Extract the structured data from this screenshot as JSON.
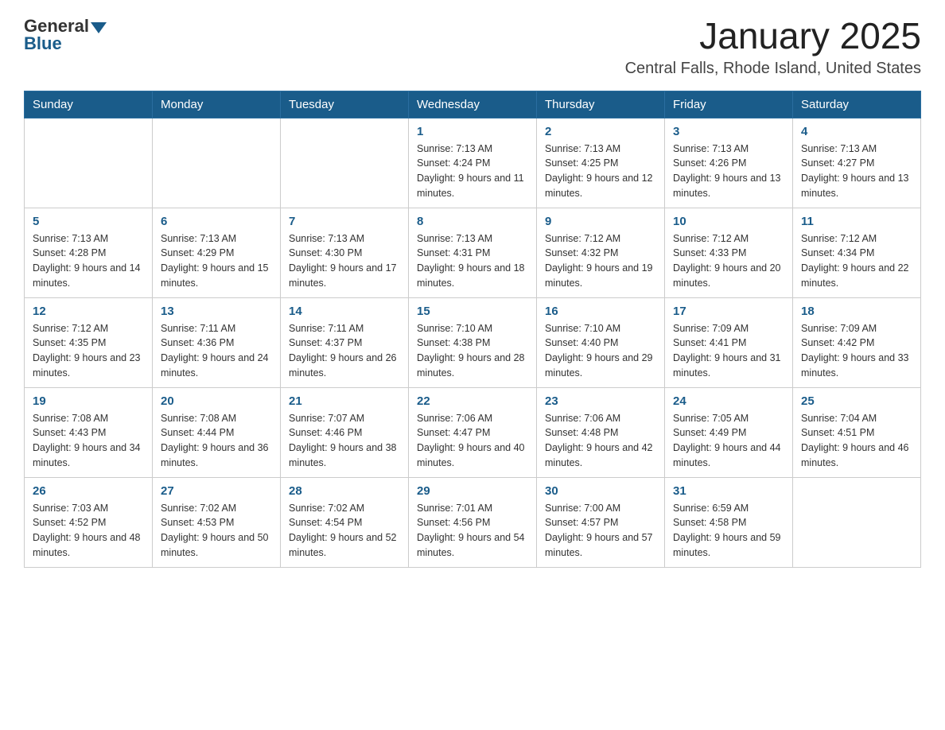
{
  "logo": {
    "general": "General",
    "blue": "Blue"
  },
  "title": {
    "month_year": "January 2025",
    "location": "Central Falls, Rhode Island, United States"
  },
  "days_of_week": [
    "Sunday",
    "Monday",
    "Tuesday",
    "Wednesday",
    "Thursday",
    "Friday",
    "Saturday"
  ],
  "weeks": [
    [
      {
        "day": "",
        "info": ""
      },
      {
        "day": "",
        "info": ""
      },
      {
        "day": "",
        "info": ""
      },
      {
        "day": "1",
        "info": "Sunrise: 7:13 AM\nSunset: 4:24 PM\nDaylight: 9 hours and 11 minutes."
      },
      {
        "day": "2",
        "info": "Sunrise: 7:13 AM\nSunset: 4:25 PM\nDaylight: 9 hours and 12 minutes."
      },
      {
        "day": "3",
        "info": "Sunrise: 7:13 AM\nSunset: 4:26 PM\nDaylight: 9 hours and 13 minutes."
      },
      {
        "day": "4",
        "info": "Sunrise: 7:13 AM\nSunset: 4:27 PM\nDaylight: 9 hours and 13 minutes."
      }
    ],
    [
      {
        "day": "5",
        "info": "Sunrise: 7:13 AM\nSunset: 4:28 PM\nDaylight: 9 hours and 14 minutes."
      },
      {
        "day": "6",
        "info": "Sunrise: 7:13 AM\nSunset: 4:29 PM\nDaylight: 9 hours and 15 minutes."
      },
      {
        "day": "7",
        "info": "Sunrise: 7:13 AM\nSunset: 4:30 PM\nDaylight: 9 hours and 17 minutes."
      },
      {
        "day": "8",
        "info": "Sunrise: 7:13 AM\nSunset: 4:31 PM\nDaylight: 9 hours and 18 minutes."
      },
      {
        "day": "9",
        "info": "Sunrise: 7:12 AM\nSunset: 4:32 PM\nDaylight: 9 hours and 19 minutes."
      },
      {
        "day": "10",
        "info": "Sunrise: 7:12 AM\nSunset: 4:33 PM\nDaylight: 9 hours and 20 minutes."
      },
      {
        "day": "11",
        "info": "Sunrise: 7:12 AM\nSunset: 4:34 PM\nDaylight: 9 hours and 22 minutes."
      }
    ],
    [
      {
        "day": "12",
        "info": "Sunrise: 7:12 AM\nSunset: 4:35 PM\nDaylight: 9 hours and 23 minutes."
      },
      {
        "day": "13",
        "info": "Sunrise: 7:11 AM\nSunset: 4:36 PM\nDaylight: 9 hours and 24 minutes."
      },
      {
        "day": "14",
        "info": "Sunrise: 7:11 AM\nSunset: 4:37 PM\nDaylight: 9 hours and 26 minutes."
      },
      {
        "day": "15",
        "info": "Sunrise: 7:10 AM\nSunset: 4:38 PM\nDaylight: 9 hours and 28 minutes."
      },
      {
        "day": "16",
        "info": "Sunrise: 7:10 AM\nSunset: 4:40 PM\nDaylight: 9 hours and 29 minutes."
      },
      {
        "day": "17",
        "info": "Sunrise: 7:09 AM\nSunset: 4:41 PM\nDaylight: 9 hours and 31 minutes."
      },
      {
        "day": "18",
        "info": "Sunrise: 7:09 AM\nSunset: 4:42 PM\nDaylight: 9 hours and 33 minutes."
      }
    ],
    [
      {
        "day": "19",
        "info": "Sunrise: 7:08 AM\nSunset: 4:43 PM\nDaylight: 9 hours and 34 minutes."
      },
      {
        "day": "20",
        "info": "Sunrise: 7:08 AM\nSunset: 4:44 PM\nDaylight: 9 hours and 36 minutes."
      },
      {
        "day": "21",
        "info": "Sunrise: 7:07 AM\nSunset: 4:46 PM\nDaylight: 9 hours and 38 minutes."
      },
      {
        "day": "22",
        "info": "Sunrise: 7:06 AM\nSunset: 4:47 PM\nDaylight: 9 hours and 40 minutes."
      },
      {
        "day": "23",
        "info": "Sunrise: 7:06 AM\nSunset: 4:48 PM\nDaylight: 9 hours and 42 minutes."
      },
      {
        "day": "24",
        "info": "Sunrise: 7:05 AM\nSunset: 4:49 PM\nDaylight: 9 hours and 44 minutes."
      },
      {
        "day": "25",
        "info": "Sunrise: 7:04 AM\nSunset: 4:51 PM\nDaylight: 9 hours and 46 minutes."
      }
    ],
    [
      {
        "day": "26",
        "info": "Sunrise: 7:03 AM\nSunset: 4:52 PM\nDaylight: 9 hours and 48 minutes."
      },
      {
        "day": "27",
        "info": "Sunrise: 7:02 AM\nSunset: 4:53 PM\nDaylight: 9 hours and 50 minutes."
      },
      {
        "day": "28",
        "info": "Sunrise: 7:02 AM\nSunset: 4:54 PM\nDaylight: 9 hours and 52 minutes."
      },
      {
        "day": "29",
        "info": "Sunrise: 7:01 AM\nSunset: 4:56 PM\nDaylight: 9 hours and 54 minutes."
      },
      {
        "day": "30",
        "info": "Sunrise: 7:00 AM\nSunset: 4:57 PM\nDaylight: 9 hours and 57 minutes."
      },
      {
        "day": "31",
        "info": "Sunrise: 6:59 AM\nSunset: 4:58 PM\nDaylight: 9 hours and 59 minutes."
      },
      {
        "day": "",
        "info": ""
      }
    ]
  ]
}
